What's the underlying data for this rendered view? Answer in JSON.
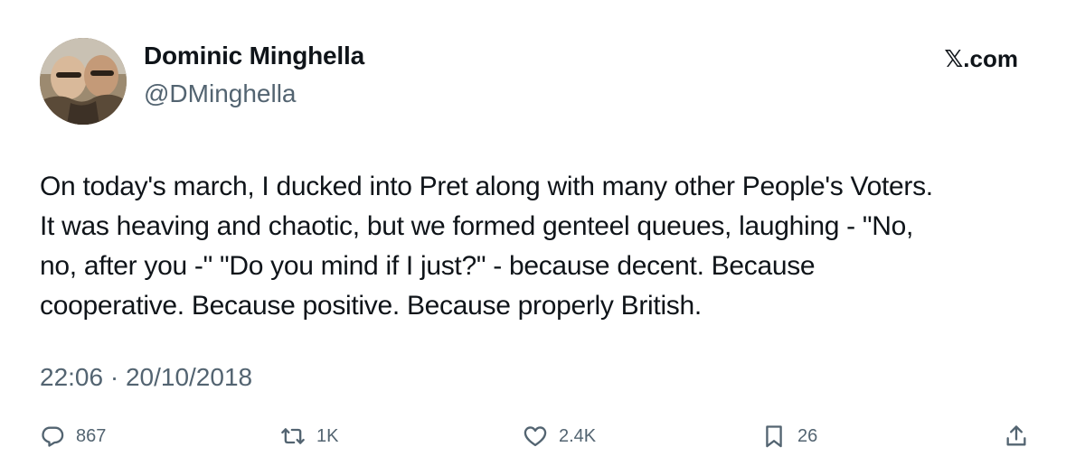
{
  "author": {
    "display_name": "Dominic Minghella",
    "handle": "@DMinghella"
  },
  "brand": "𝕏.com",
  "tweet": {
    "lines": [
      "On today's march, I ducked into Pret along with many other People's Voters.",
      "It was heaving and chaotic, but we formed genteel queues, laughing - \"No,",
      "no, after you -\" \"Do you mind if I just?\" - because decent. Because",
      "cooperative. Because positive. Because properly British."
    ],
    "timestamp": "22:06 · 20/10/2018"
  },
  "actions": {
    "replies": "867",
    "reposts": "1K",
    "likes": "2.4K",
    "bookmarks": "26"
  },
  "icons": [
    "reply-icon",
    "repost-icon",
    "like-icon",
    "bookmark-icon",
    "share-icon"
  ],
  "colors": {
    "text": "#0f1419",
    "secondary": "#536471",
    "background": "#ffffff"
  }
}
